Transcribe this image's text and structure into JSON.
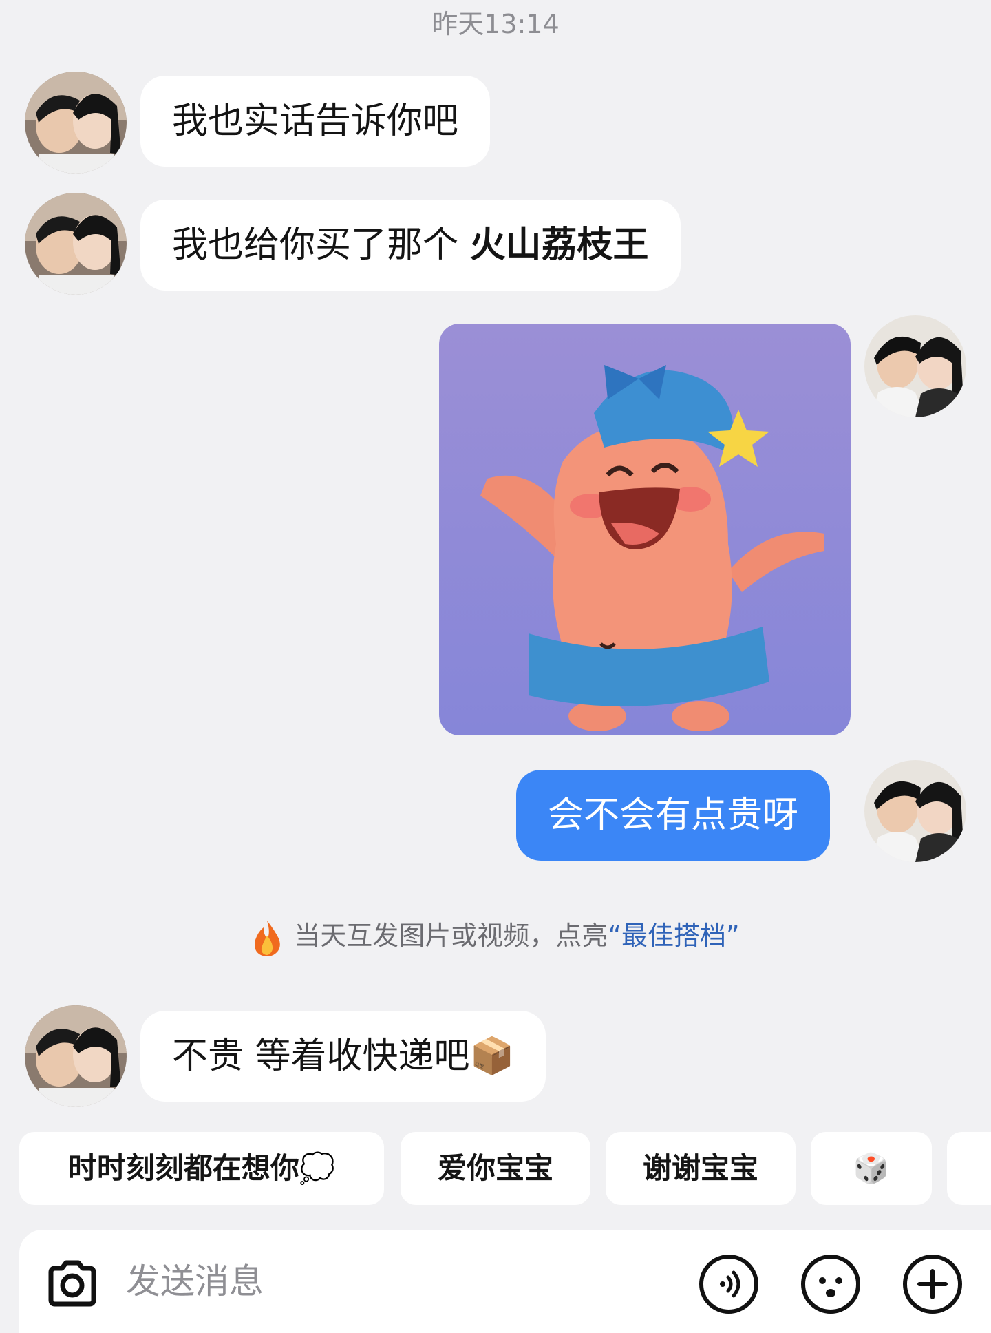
{
  "header": {
    "timestamp": "昨天13:14"
  },
  "messages": [
    {
      "sender": "other",
      "text": "我也实话告诉你吧"
    },
    {
      "sender": "other",
      "text_prefix": "我也给你买了那个 ",
      "text_bold": "火山荔枝王"
    },
    {
      "sender": "self",
      "type": "sticker",
      "sticker_icon": "patrick-star-sticker"
    },
    {
      "sender": "self",
      "text": "会不会有点贵呀"
    },
    {
      "sender": "other",
      "text": "不贵 等着收快递吧",
      "emoji": "📦"
    }
  ],
  "notice": {
    "text": "当天互发图片或视频，点亮",
    "highlight": "“最佳搭档”",
    "icon": "fire-icon"
  },
  "quick_replies": [
    {
      "label": "时时刻刻都在想你",
      "emoji": "💭"
    },
    {
      "label": "爱你宝宝"
    },
    {
      "label": "谢谢宝宝"
    },
    {
      "label": "",
      "emoji": "🎲"
    }
  ],
  "input": {
    "placeholder": "发送消息"
  },
  "colors": {
    "background": "#f1f1f3",
    "self_bubble": "#3b86f6",
    "other_bubble": "#ffffff",
    "highlight_text": "#2f63b8"
  }
}
